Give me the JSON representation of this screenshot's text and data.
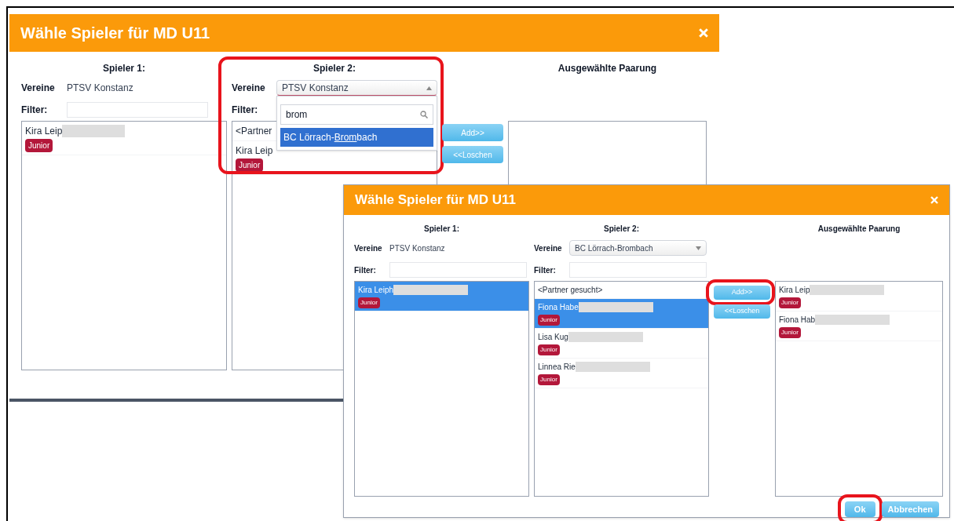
{
  "dialogs": [
    {
      "title": "Wähle Spieler für MD U11",
      "player1": {
        "heading": "Spieler 1:",
        "club_label": "Vereine",
        "club": "PTSV Konstanz",
        "filter_label": "Filter:",
        "players": [
          {
            "name": "Kira Leip",
            "redacted": true,
            "tag": "Junior",
            "selected": false
          }
        ]
      },
      "player2": {
        "heading": "Spieler 2:",
        "club_label": "Vereine",
        "club_select": {
          "value": "PTSV Konstanz",
          "open": true,
          "search": "brom",
          "options": [
            {
              "text_before": "BC Lörrach-",
              "match": "Brom",
              "text_after": "bach",
              "selected": true
            }
          ]
        },
        "filter_label": "Filter:",
        "highlighted": true,
        "players": [
          {
            "name": "<Partner",
            "redacted": false,
            "selected": false
          },
          {
            "name": "Kira Leip",
            "redacted": false,
            "tag": "Junior",
            "selected": false
          }
        ]
      },
      "buttons": [
        {
          "label": "Add>>",
          "highlighted": false
        },
        {
          "label": "<<Loschen",
          "highlighted": false
        }
      ],
      "pairing": {
        "heading": "Ausgewählte Paarung"
      }
    },
    {
      "title": "Wähle Spieler für MD U11",
      "player1": {
        "heading": "Spieler 1:",
        "club_label": "Vereine",
        "club": "PTSV Konstanz",
        "filter_label": "Filter:",
        "players": [
          {
            "name": "Kira Leiph",
            "redacted": true,
            "tag": "Junior",
            "selected": true
          }
        ]
      },
      "player2": {
        "heading": "Spieler 2:",
        "club_label": "Vereine",
        "club_select": {
          "value": "BC Lörrach-Brombach",
          "open": false
        },
        "filter_label": "Filter:",
        "players": [
          {
            "name": "<Partner gesucht>",
            "redacted": false,
            "selected": false
          },
          {
            "name": "Fiona Habe",
            "redacted": true,
            "tag": "Junior",
            "selected": true
          },
          {
            "name": "Lisa Kug",
            "redacted": true,
            "tag": "Junior",
            "selected": false
          },
          {
            "name": "Linnea Rie",
            "redacted": true,
            "tag": "Junior",
            "selected": false
          }
        ]
      },
      "buttons": [
        {
          "label": "Add>>",
          "highlighted": true
        },
        {
          "label": "<<Loschen",
          "highlighted": false
        }
      ],
      "pairing": {
        "heading": "Ausgewählte Paarung",
        "players": [
          {
            "name": "Kira Leip",
            "redacted": true,
            "tag": "Junior",
            "selected": false
          },
          {
            "name": "Fiona Hab",
            "redacted": true,
            "tag": "Junior",
            "selected": false
          }
        ]
      },
      "footer_buttons": [
        {
          "label": "Ok",
          "highlighted": true
        },
        {
          "label": "Abbrechen"
        }
      ]
    }
  ]
}
